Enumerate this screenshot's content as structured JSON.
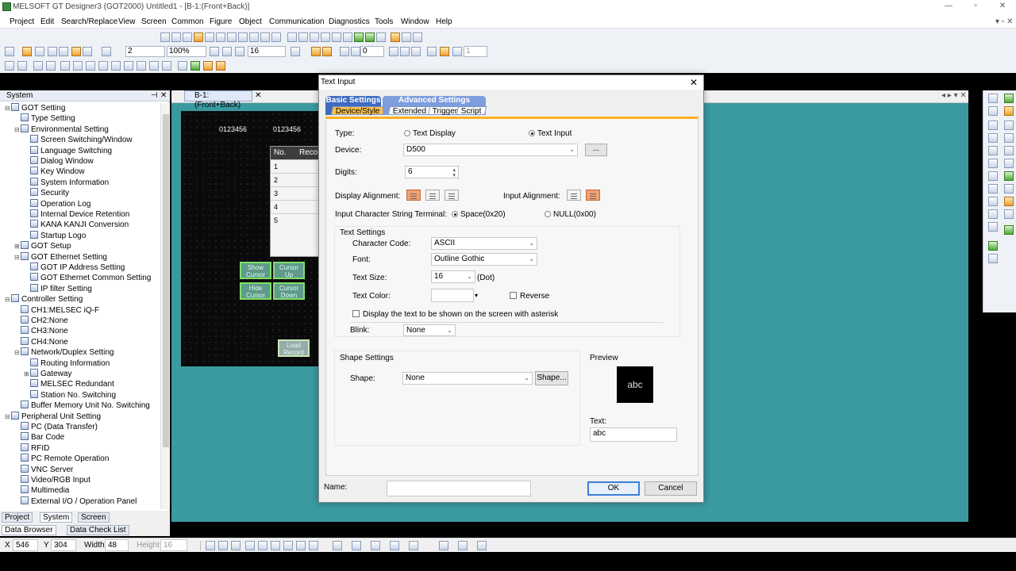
{
  "window": {
    "title": "MELSOFT GT Designer3 (GOT2000) Untitled1 - [B-1:(Front+Back)]",
    "min": "—",
    "max": "▫",
    "close": "✕"
  },
  "menu": [
    "Project",
    "Edit",
    "Search/Replace",
    "View",
    "Screen",
    "Common",
    "Figure",
    "Object",
    "Communication",
    "Diagnostics",
    "Tools",
    "Window",
    "Help"
  ],
  "toolbar": {
    "screen_no": "2",
    "zoom": "100%",
    "grid": "16",
    "sel_0": "0",
    "sel_1": "1"
  },
  "panel": {
    "title": "System",
    "tree": [
      {
        "label": "GOT Setting",
        "indent": 0,
        "toggle": "⊟"
      },
      {
        "label": "Type Setting",
        "indent": 1,
        "toggle": ""
      },
      {
        "label": "Environmental Setting",
        "indent": 1,
        "toggle": "⊟"
      },
      {
        "label": "Screen Switching/Window",
        "indent": 2,
        "toggle": ""
      },
      {
        "label": "Language Switching",
        "indent": 2,
        "toggle": ""
      },
      {
        "label": "Dialog Window",
        "indent": 2,
        "toggle": ""
      },
      {
        "label": "Key Window",
        "indent": 2,
        "toggle": ""
      },
      {
        "label": "System Information",
        "indent": 2,
        "toggle": ""
      },
      {
        "label": "Security",
        "indent": 2,
        "toggle": ""
      },
      {
        "label": "Operation Log",
        "indent": 2,
        "toggle": ""
      },
      {
        "label": "Internal Device Retention",
        "indent": 2,
        "toggle": ""
      },
      {
        "label": "KANA KANJI Conversion",
        "indent": 2,
        "toggle": ""
      },
      {
        "label": "Startup Logo",
        "indent": 2,
        "toggle": ""
      },
      {
        "label": "GOT Setup",
        "indent": 1,
        "toggle": "⊞"
      },
      {
        "label": "GOT Ethernet Setting",
        "indent": 1,
        "toggle": "⊟"
      },
      {
        "label": "GOT IP Address Setting",
        "indent": 2,
        "toggle": ""
      },
      {
        "label": "GOT Ethernet Common Setting",
        "indent": 2,
        "toggle": ""
      },
      {
        "label": "IP filter Setting",
        "indent": 2,
        "toggle": ""
      },
      {
        "label": "Controller Setting",
        "indent": 0,
        "toggle": "⊟"
      },
      {
        "label": "CH1:MELSEC iQ-F",
        "indent": 1,
        "toggle": ""
      },
      {
        "label": "CH2:None",
        "indent": 1,
        "toggle": ""
      },
      {
        "label": "CH3:None",
        "indent": 1,
        "toggle": ""
      },
      {
        "label": "CH4:None",
        "indent": 1,
        "toggle": ""
      },
      {
        "label": "Network/Duplex Setting",
        "indent": 1,
        "toggle": "⊟"
      },
      {
        "label": "Routing Information",
        "indent": 2,
        "toggle": ""
      },
      {
        "label": "Gateway",
        "indent": 2,
        "toggle": "⊞"
      },
      {
        "label": "MELSEC Redundant",
        "indent": 2,
        "toggle": ""
      },
      {
        "label": "Station No. Switching",
        "indent": 2,
        "toggle": ""
      },
      {
        "label": "Buffer Memory Unit No. Switching",
        "indent": 1,
        "toggle": ""
      },
      {
        "label": "Peripheral Unit Setting",
        "indent": 0,
        "toggle": "⊟"
      },
      {
        "label": "PC (Data Transfer)",
        "indent": 1,
        "toggle": ""
      },
      {
        "label": "Bar Code",
        "indent": 1,
        "toggle": ""
      },
      {
        "label": "RFID",
        "indent": 1,
        "toggle": ""
      },
      {
        "label": "PC Remote Operation",
        "indent": 1,
        "toggle": ""
      },
      {
        "label": "VNC Server",
        "indent": 1,
        "toggle": ""
      },
      {
        "label": "Video/RGB Input",
        "indent": 1,
        "toggle": ""
      },
      {
        "label": "Multimedia",
        "indent": 1,
        "toggle": ""
      },
      {
        "label": "External I/O / Operation Panel",
        "indent": 1,
        "toggle": ""
      }
    ],
    "bottom_tabs": [
      "Project",
      "System",
      "Screen"
    ],
    "bottom_tabs2": [
      "Data Browser",
      "Data Check List"
    ]
  },
  "doc_tab": "B-1:(Front+Back)",
  "screen": {
    "num1": "0123456",
    "num2": "0123456",
    "table_headers": [
      "No.",
      "Reco"
    ],
    "rows": [
      "1",
      "2",
      "3",
      "4",
      "5"
    ],
    "buttons": [
      [
        "Show",
        "Cursor"
      ],
      [
        "Cursor",
        "Up"
      ],
      [
        "Hide",
        "Cursor"
      ],
      [
        "Cursor",
        "Down"
      ],
      [
        "Load",
        "Record"
      ]
    ]
  },
  "status": {
    "x_label": "X",
    "x": "546",
    "y_label": "Y",
    "y": "304",
    "w_label": "Width",
    "w": "48",
    "h_label": "Height",
    "h": "16"
  },
  "dialog": {
    "title": "Text Input",
    "tab_basic": "Basic Settings",
    "tab_advanced": "Advanced Settings",
    "sub_device": "Device/Style",
    "sub_extended": "Extended",
    "sub_trigger": "Trigger",
    "sub_script": "Script",
    "type_label": "Type:",
    "type_display": "Text Display",
    "type_input": "Text Input",
    "device_label": "Device:",
    "device_value": "D500",
    "browse": "...",
    "digits_label": "Digits:",
    "digits_value": "6",
    "display_align_label": "Display Alignment:",
    "input_align_label": "Input Alignment:",
    "terminal_label": "Input Character String Terminal:",
    "terminal_space": "Space(0x20)",
    "terminal_null": "NULL(0x00)",
    "text_settings": "Text Settings",
    "char_code_label": "Character Code:",
    "char_code": "ASCII",
    "font_label": "Font:",
    "font_value": "Outline Gothic",
    "text_size_label": "Text Size:",
    "text_size": "16",
    "text_size_unit": "(Dot)",
    "text_color_label": "Text Color:",
    "reverse": "Reverse",
    "asterisk": "Display the text to be shown on the screen with asterisk",
    "blink_label": "Blink:",
    "blink_value": "None",
    "shape_settings": "Shape Settings",
    "shape_label": "Shape:",
    "shape_value": "None",
    "shape_btn": "Shape...",
    "preview_label": "Preview",
    "preview_text": "abc",
    "text_label": "Text:",
    "text_value": "abc",
    "name_label": "Name:",
    "name_value": "",
    "ok": "OK",
    "cancel": "Cancel"
  },
  "colors": {
    "accent_tab": "#ffb020",
    "workarea": "#3a9aa0",
    "tab_blue": "#4a78c8"
  }
}
